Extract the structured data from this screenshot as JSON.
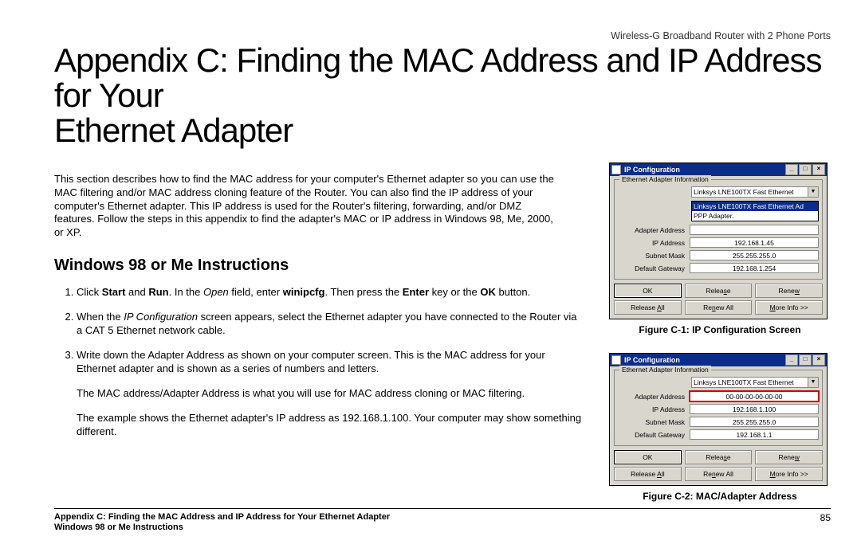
{
  "header": {
    "product": "Wireless-G Broadband Router with 2 Phone Ports",
    "title_line1": "Appendix C: Finding the MAC Address and IP Address for Your",
    "title_line2": "Ethernet Adapter"
  },
  "intro": "This section describes how to find the MAC address for your computer's Ethernet adapter so you can use the MAC filtering and/or MAC address cloning feature of the Router. You can also find the IP address of your computer's Ethernet adapter. This IP address is used for the Router's filtering, forwarding, and/or DMZ features. Follow the steps in this appendix to find the adapter's MAC or IP address in Windows 98, Me, 2000, or XP.",
  "section_head": "Windows 98 or Me Instructions",
  "steps": {
    "s1": {
      "pre": "Click ",
      "b1": "Start",
      "mid1": " and ",
      "b2": "Run",
      "mid2": ". In the ",
      "i1": "Open",
      "mid3": " field, enter ",
      "b3": "winipcfg",
      "mid4": ". Then press the ",
      "b4": "Enter",
      "mid5": " key or the ",
      "b5": "OK",
      "post": " button."
    },
    "s2": {
      "pre": "When the ",
      "i1": "IP Configuration",
      "post": " screen appears, select the Ethernet adapter you have connected to the Router via a CAT 5 Ethernet network cable."
    },
    "s3": {
      "main": "Write down the Adapter Address as shown on your computer screen. This is the MAC address for your Ethernet adapter and is shown as a series of numbers and letters.",
      "extra1": "The MAC address/Adapter Address is what you will use for MAC address cloning or MAC filtering.",
      "extra2": "The example shows the Ethernet adapter's IP address as 192.168.1.100. Your computer may show something different."
    }
  },
  "window_common": {
    "title": "IP Configuration",
    "group_legend": "Ethernet  Adapter Information",
    "adapter_selected": "Linksys LNE100TX Fast Ethernet",
    "labels": {
      "adapter_address": "Adapter Address",
      "ip_address": "IP Address",
      "subnet": "Subnet Mask",
      "gateway": "Default Gateway"
    },
    "buttons": {
      "ok": "OK",
      "release": "Release",
      "renew": "Renew",
      "release_all": "Release All",
      "renew_all": "Renew All",
      "more_info": "More Info >>"
    },
    "popup_options": [
      "Linksys LNE100TX Fast Ethernet Ad",
      "PPP Adapter."
    ]
  },
  "fig1": {
    "caption": "Figure C-1: IP Configuration Screen",
    "values": {
      "adapter_address": "",
      "ip": "192.168.1.45",
      "subnet": "255.255.255.0",
      "gateway": "192.168.1.254"
    }
  },
  "fig2": {
    "caption": "Figure C-2: MAC/Adapter Address",
    "values": {
      "adapter_address": "00-00-00-00-00-00",
      "ip": "192.168.1.100",
      "subnet": "255.255.255.0",
      "gateway": "192.168.1.1"
    }
  },
  "footer": {
    "line1": "Appendix C: Finding the MAC Address and IP Address for Your Ethernet Adapter",
    "line2": "Windows 98 or Me Instructions",
    "page": "85"
  }
}
